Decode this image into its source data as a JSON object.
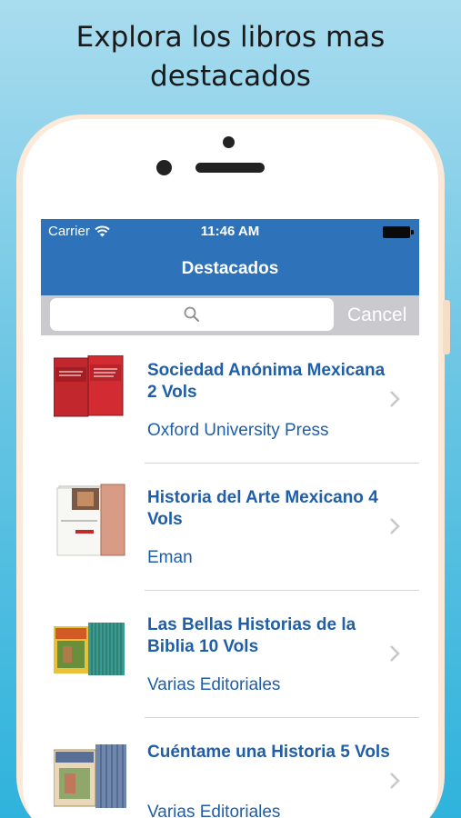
{
  "headline": "Explora los libros mas destacados",
  "status_bar": {
    "carrier": "Carrier",
    "time": "11:46 AM"
  },
  "nav": {
    "title": "Destacados"
  },
  "search": {
    "placeholder": "",
    "cancel_label": "Cancel"
  },
  "books": [
    {
      "title": "Sociedad Anónima Mexicana 2 Vols",
      "publisher": "Oxford University Press"
    },
    {
      "title": "Historia del Arte Mexicano 4 Vols",
      "publisher": "Eman"
    },
    {
      "title": "Las Bellas Historias de la Biblia 10 Vols",
      "publisher": "Varias Editoriales"
    },
    {
      "title": "Cuéntame una Historia 5 Vols",
      "publisher": "Varias Editoriales"
    }
  ],
  "icons": [
    "wifi-icon",
    "battery-icon",
    "search-icon",
    "chevron-right-icon"
  ],
  "colors": {
    "nav_bar": "#2e73b9",
    "link_text": "#1f5ea8",
    "search_bar": "#c9c9ce",
    "background_top": "#a9dcef",
    "background_bottom": "#2fb3dc"
  }
}
